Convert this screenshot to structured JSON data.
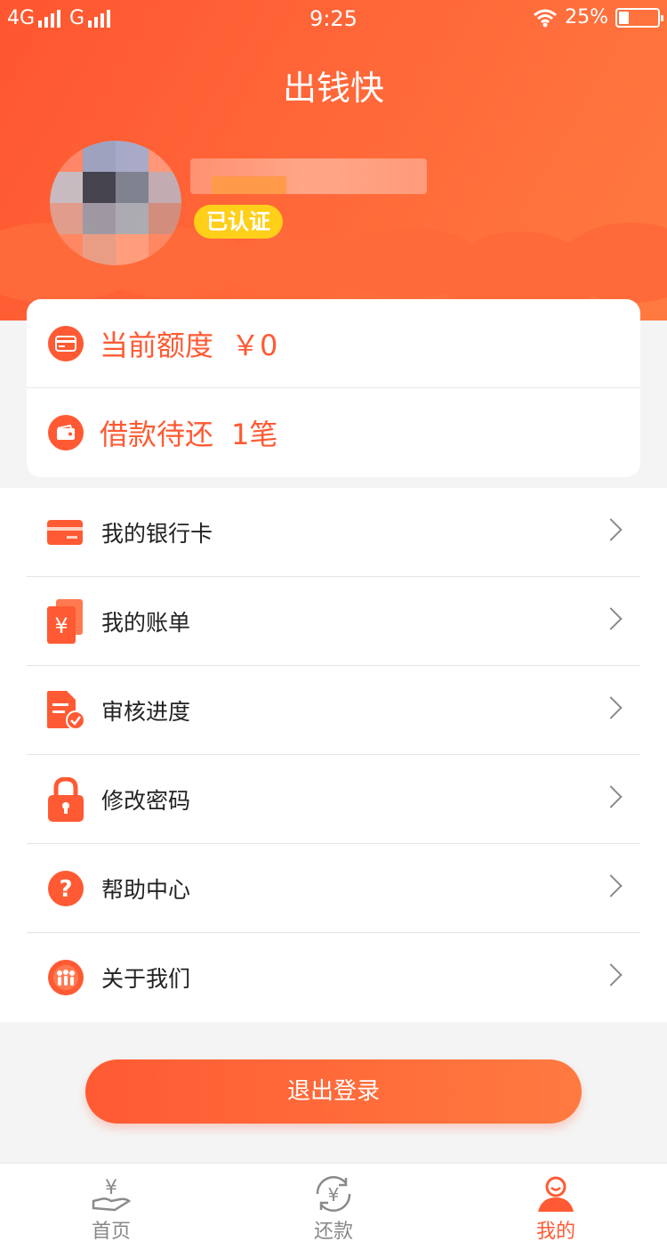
{
  "status_bar": {
    "network_1": "4G",
    "network_2": "G",
    "time": "9:25",
    "battery": "25%",
    "battery_level": 0.25
  },
  "header": {
    "title": "出钱快",
    "verified_badge": "已认证"
  },
  "summary": {
    "credit_label": "当前额度",
    "credit_value": "￥0",
    "credit_icon": "card-icon",
    "loan_label": "借款待还",
    "loan_value": "1笔",
    "loan_icon": "wallet-icon"
  },
  "menu": {
    "items": [
      {
        "label": "我的银行卡",
        "icon": "bank-card-icon"
      },
      {
        "label": "我的账单",
        "icon": "bill-icon"
      },
      {
        "label": "审核进度",
        "icon": "review-progress-icon"
      },
      {
        "label": "修改密码",
        "icon": "lock-icon"
      },
      {
        "label": "帮助中心",
        "icon": "help-icon"
      },
      {
        "label": "关于我们",
        "icon": "about-us-icon"
      }
    ]
  },
  "logout": {
    "label": "退出登录"
  },
  "tabs": [
    {
      "label": "首页",
      "icon": "home-yen-icon",
      "active": false
    },
    {
      "label": "还款",
      "icon": "repay-icon",
      "active": false
    },
    {
      "label": "我的",
      "icon": "profile-icon",
      "active": true
    }
  ],
  "colors": {
    "primary": "#ff5a33",
    "badge": "#ffcf1a"
  }
}
